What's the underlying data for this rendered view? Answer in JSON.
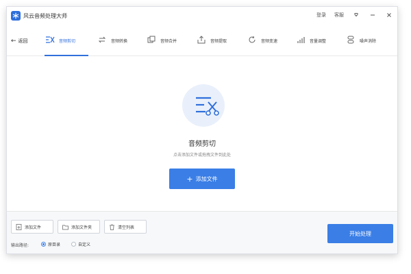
{
  "app": {
    "title": "风云音频处理大师",
    "logo_icon": "app-logo-icon",
    "brand_color": "#2f6fdc"
  },
  "titlebar": {
    "login": "登录",
    "service": "客服",
    "menu_icon": "menu-arrow-icon",
    "minimize_icon": "minimize-icon",
    "close_icon": "close-icon"
  },
  "toolbar": {
    "back_label": "返回",
    "tabs": [
      {
        "label": "音频剪切",
        "icon": "audio-cut-icon",
        "active": true
      },
      {
        "label": "音频转换",
        "icon": "audio-convert-icon",
        "active": false
      },
      {
        "label": "音频合并",
        "icon": "audio-merge-icon",
        "active": false
      },
      {
        "label": "音频提取",
        "icon": "audio-extract-icon",
        "active": false
      },
      {
        "label": "音频变速",
        "icon": "audio-speed-icon",
        "active": false
      },
      {
        "label": "音量调整",
        "icon": "volume-adjust-icon",
        "active": false
      },
      {
        "label": "噪声消除",
        "icon": "noise-remove-icon",
        "active": false
      }
    ]
  },
  "main": {
    "feature_icon": "audio-cut-scissors-icon",
    "feature_title": "音频剪切",
    "hint": "点击添加文件或拖拽文件到此处",
    "add_file_button": "添加文件"
  },
  "bottom": {
    "add_file": "添加文件",
    "add_folder": "添加文件夹",
    "clear_list": "清空列表",
    "output_label": "输出路径:",
    "output_options": [
      {
        "label": "原目录",
        "checked": true
      },
      {
        "label": "自定义",
        "checked": false
      }
    ],
    "start_button": "开始处理"
  },
  "colors": {
    "accent": "#3a7ee6",
    "active_tab": "#2f6fdc",
    "hero_circle": "#e9f0fb"
  }
}
